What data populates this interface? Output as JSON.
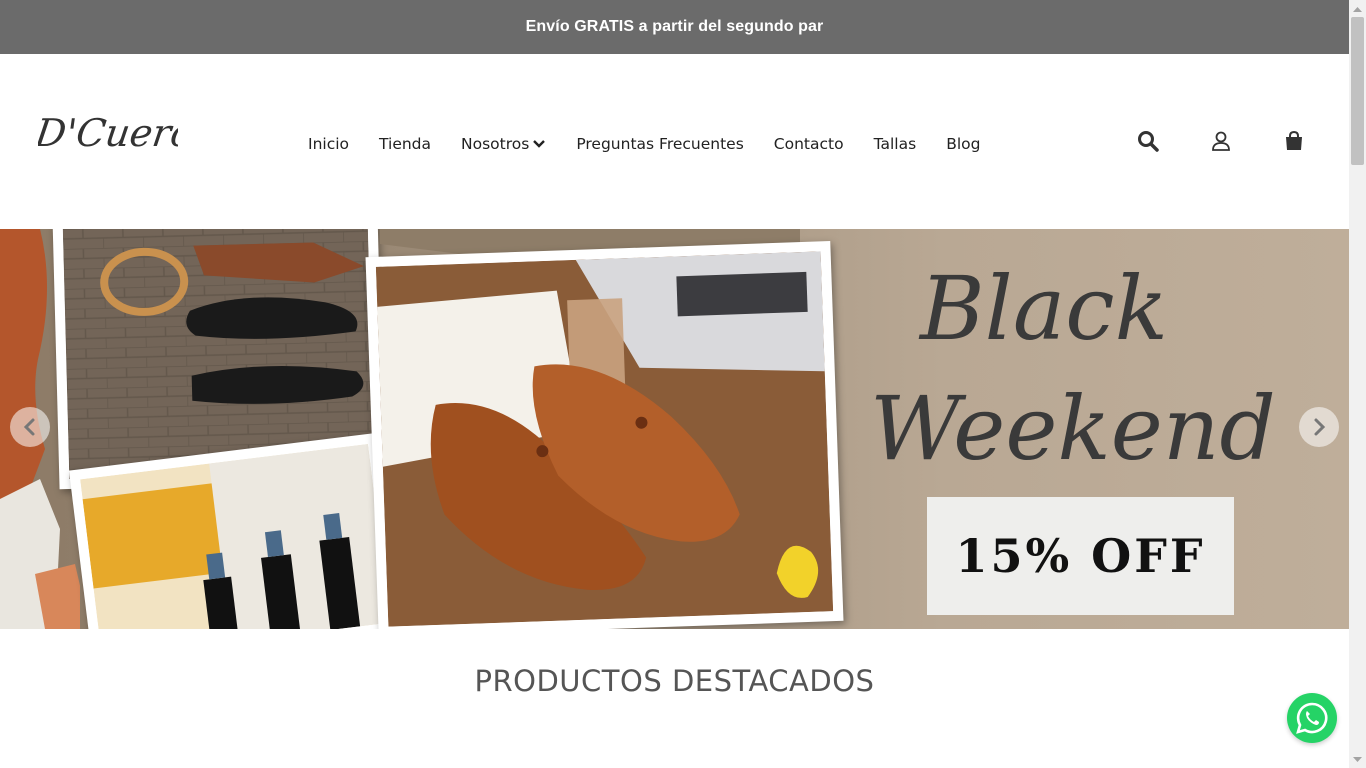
{
  "announcement": "Envío GRATIS a partir del segundo par",
  "brand": {
    "logo_text": "D'Cuero"
  },
  "nav": {
    "items": [
      {
        "label": "Inicio"
      },
      {
        "label": "Tienda"
      },
      {
        "label": "Nosotros"
      },
      {
        "label": "Preguntas Frecuentes"
      },
      {
        "label": "Contacto"
      },
      {
        "label": "Tallas"
      },
      {
        "label": "Blog"
      }
    ]
  },
  "header_icons": [
    "search-icon",
    "user-icon",
    "shopping-bag-icon"
  ],
  "hero": {
    "headline_line1": "Black",
    "headline_line2": "Weekend",
    "offer": "15% OFF"
  },
  "featured": {
    "title": "PRODUCTOS DESTACADOS"
  },
  "colors": {
    "topbar": "#6b6b6b",
    "whatsapp": "#25d366",
    "text": "#222222"
  }
}
